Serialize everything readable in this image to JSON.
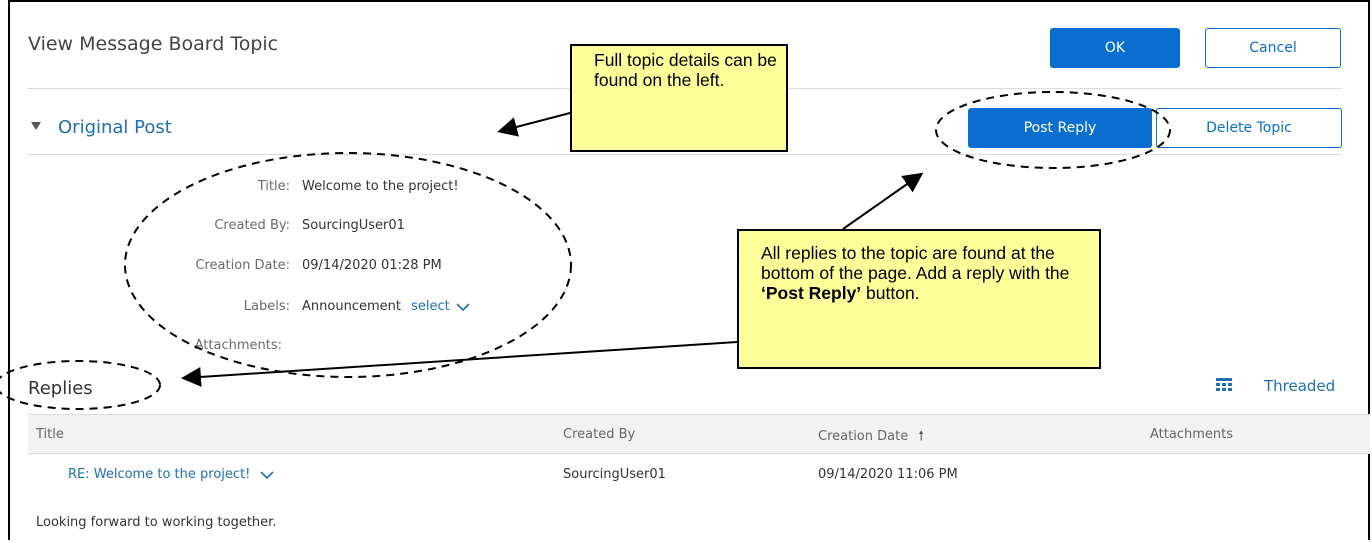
{
  "header": {
    "title": "View Message Board Topic",
    "ok_label": "OK",
    "cancel_label": "Cancel"
  },
  "original_post": {
    "section_title": "Original Post",
    "post_reply_label": "Post Reply",
    "delete_topic_label": "Delete Topic",
    "fields": {
      "title_label": "Title:",
      "title_value": "Welcome to the project!",
      "created_by_label": "Created By:",
      "created_by_value": "SourcingUser01",
      "creation_date_label": "Creation Date:",
      "creation_date_value": "09/14/2020 01:28 PM",
      "labels_label": "Labels:",
      "labels_value": "Announcement",
      "labels_select": "select",
      "attachments_label": "Attachments:"
    }
  },
  "replies": {
    "title": "Replies",
    "view_mode": "Threaded",
    "columns": {
      "title": "Title",
      "created_by": "Created By",
      "creation_date": "Creation Date",
      "attachments": "Attachments"
    },
    "rows": [
      {
        "title": "RE: Welcome to the project!",
        "created_by": "SourcingUser01",
        "creation_date": "09/14/2020 11:06 PM",
        "body": "Looking forward to working together."
      }
    ]
  },
  "callouts": {
    "top": "Full topic details can be found on the left.",
    "bottom_plain": "All replies to the topic are found at the bottom of the page. Add a reply with the",
    "bottom_bold": "‘Post Reply’",
    "bottom_tail": "button."
  },
  "colors": {
    "accent": "#0a6ed1",
    "link": "#1f6fb2",
    "callout_bg": "#ffff99"
  }
}
